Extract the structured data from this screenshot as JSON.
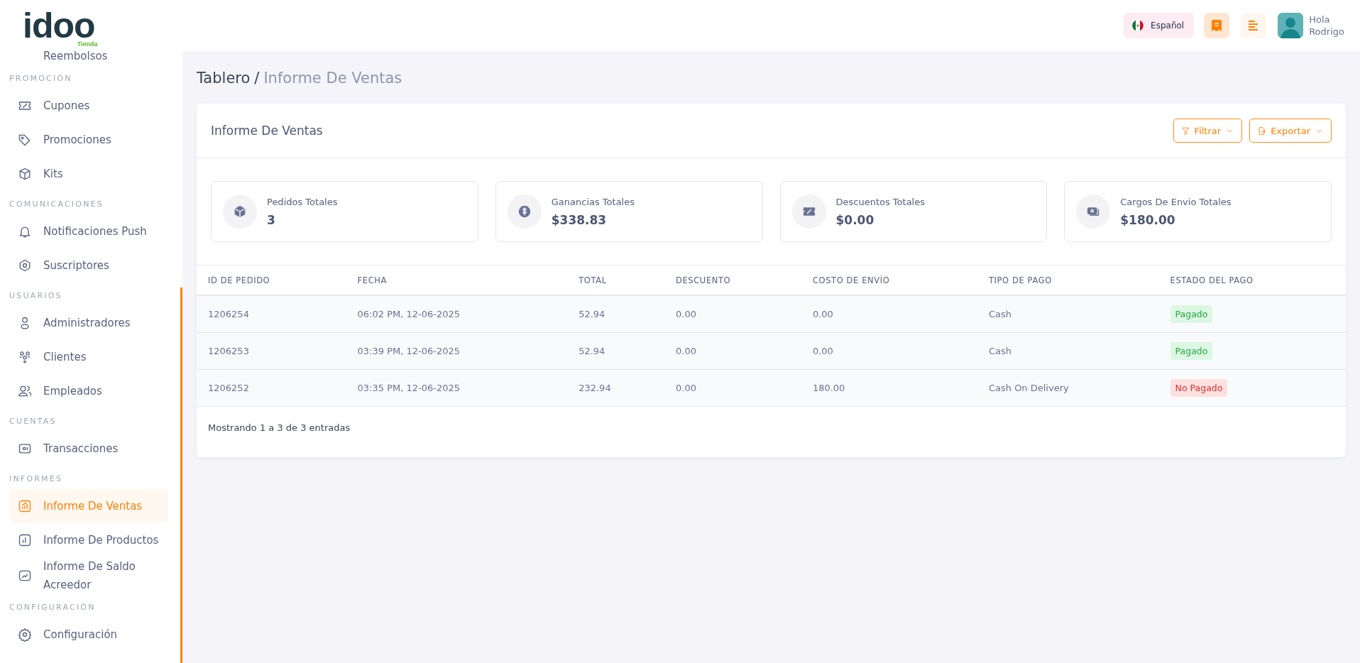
{
  "logo": {
    "text": "idoo",
    "tagline": "Tienda"
  },
  "header": {
    "language": "Español",
    "greeting": "Hola",
    "user": "Rodrigo"
  },
  "sidebar": {
    "sections": [
      {
        "items": [
          {
            "label": "Reembolsos",
            "selected": false
          }
        ]
      },
      {
        "heading": "PROMOCIÓN",
        "items": [
          {
            "label": "Cupones",
            "selected": false
          },
          {
            "label": "Promociones",
            "selected": false
          },
          {
            "label": "Kits",
            "selected": false
          }
        ]
      },
      {
        "heading": "COMUNICACIONES",
        "items": [
          {
            "label": "Notificaciones Push",
            "selected": false
          },
          {
            "label": "Suscriptores",
            "selected": false
          }
        ]
      },
      {
        "heading": "USUARIOS",
        "items": [
          {
            "label": "Administradores",
            "selected": false
          },
          {
            "label": "Clientes",
            "selected": false
          },
          {
            "label": "Empleados",
            "selected": false
          }
        ]
      },
      {
        "heading": "CUENTAS",
        "items": [
          {
            "label": "Transacciones",
            "selected": false
          }
        ]
      },
      {
        "heading": "INFORMES",
        "items": [
          {
            "label": "Informe De Ventas",
            "selected": true
          },
          {
            "label": "Informe De Productos",
            "selected": false
          },
          {
            "label": "Informe De Saldo Acreedor",
            "selected": false
          }
        ]
      },
      {
        "heading": "CONFIGURACIÓN",
        "items": [
          {
            "label": "Configuración",
            "selected": false
          }
        ]
      }
    ]
  },
  "breadcrumb": {
    "root": "Tablero",
    "separator": "/",
    "current": "Informe De Ventas"
  },
  "report": {
    "title": "Informe De Ventas",
    "buttons": [
      "Filtrar",
      "Exportar"
    ],
    "stats": [
      {
        "label": "Pedidos Totales",
        "value": "3"
      },
      {
        "label": "Ganancias Totales",
        "value": "$338.83"
      },
      {
        "label": "Descuentos Totales",
        "value": "$0.00"
      },
      {
        "label": "Cargos De Envio Totales",
        "value": "$180.00"
      }
    ],
    "table": {
      "columns": [
        "ID DE PEDIDO",
        "FECHA",
        "TOTAL",
        "DESCUENTO",
        "COSTO DE ENVÍO",
        "TIPO DE PAGO",
        "ESTADO DEL PAGO"
      ],
      "rows": [
        {
          "cells": [
            "1206254",
            "06:02 PM, 12-06-2025",
            "52.94",
            "0.00",
            "0.00",
            "Cash"
          ],
          "status": {
            "label": "Pagado",
            "kind": "paid"
          }
        },
        {
          "cells": [
            "1206253",
            "03:39 PM, 12-06-2025",
            "52.94",
            "0.00",
            "0.00",
            "Cash"
          ],
          "status": {
            "label": "Pagado",
            "kind": "paid"
          }
        },
        {
          "cells": [
            "1206252",
            "03:35 PM, 12-06-2025",
            "232.94",
            "0.00",
            "180.00",
            "Cash On Delivery"
          ],
          "status": {
            "label": "No Pagado",
            "kind": "unpaid"
          }
        }
      ]
    },
    "footer": "Mostrando 1 a 3 de 3 entradas"
  }
}
